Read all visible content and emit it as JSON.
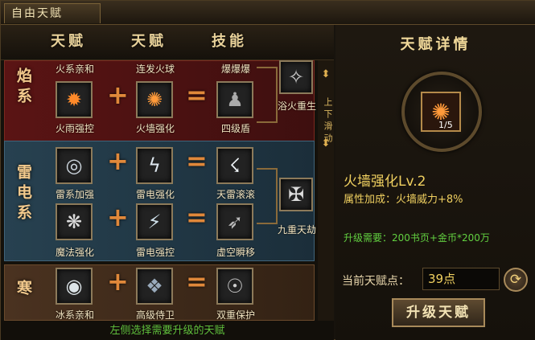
{
  "window": {
    "title": "自由天赋"
  },
  "headers": [
    "天赋",
    "天赋",
    "技能"
  ],
  "sections": [
    {
      "name": "火焰系",
      "rows": [
        {
          "a": "火系亲和",
          "b": "连发火球",
          "c": "爆爆爆"
        },
        {
          "a": "火雨强控",
          "b": "火墙强化",
          "c": "四级盾"
        }
      ],
      "result": "浴火重生"
    },
    {
      "name": "雷电系",
      "rows": [
        {
          "a": "雷系加强",
          "b": "雷电强化",
          "c": "天雷滚滚"
        },
        {
          "a": "魔法强化",
          "b": "雷电强控",
          "c": "虚空瞬移"
        }
      ],
      "result": "九重天劫"
    },
    {
      "name": "寒冰系",
      "rows": [
        {
          "a": "冰系亲和",
          "b": "高级侍卫",
          "c": "双重保护"
        }
      ]
    }
  ],
  "scroll_hint": "上下滑动",
  "footer_hint": "左侧选择需要升级的天赋",
  "detail": {
    "title": "天赋详情",
    "level_tag": "1/5",
    "name": "火墙强化Lv.2",
    "attribute": "属性加成：火墙威力+8%",
    "requirement": "升级需要：200书页+金币*200万",
    "points_label": "当前天赋点：",
    "points_value": "39点",
    "upgrade_button": "升级天赋"
  }
}
